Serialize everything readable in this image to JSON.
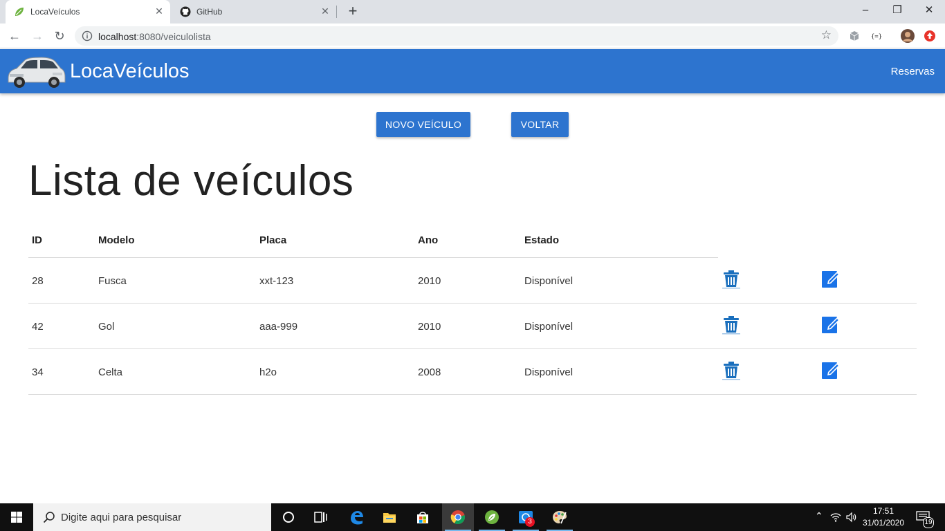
{
  "browser": {
    "tabs": [
      {
        "title": "LocaVeículos",
        "icon": "spring-leaf-icon",
        "active": true
      },
      {
        "title": "GitHub",
        "icon": "github-icon",
        "active": false
      }
    ],
    "url_host": "localhost",
    "url_path": ":8080/veiculolista"
  },
  "navbar": {
    "brand": "LocaVeículos",
    "link_reservas": "Reservas",
    "brand_color": "#2d74cf"
  },
  "actions": {
    "novo_veiculo": "NOVO VEÍCULO",
    "voltar": "VOLTAR"
  },
  "page_title": "Lista de veículos",
  "table": {
    "headers": [
      "ID",
      "Modelo",
      "Placa",
      "Ano",
      "Estado"
    ],
    "rows": [
      {
        "id": "28",
        "modelo": "Fusca",
        "placa": "xxt-123",
        "ano": "2010",
        "estado": "Disponível"
      },
      {
        "id": "42",
        "modelo": "Gol",
        "placa": "aaa-999",
        "ano": "2010",
        "estado": "Disponível"
      },
      {
        "id": "34",
        "modelo": "Celta",
        "placa": "h2o",
        "ano": "2008",
        "estado": "Disponível"
      }
    ],
    "row_actions": [
      "trash-icon",
      "edit-icon"
    ]
  },
  "taskbar": {
    "search_placeholder": "Digite aqui para pesquisar",
    "time": "17:51",
    "date": "31/01/2020",
    "notifications": "19",
    "chat_badge": "3"
  }
}
